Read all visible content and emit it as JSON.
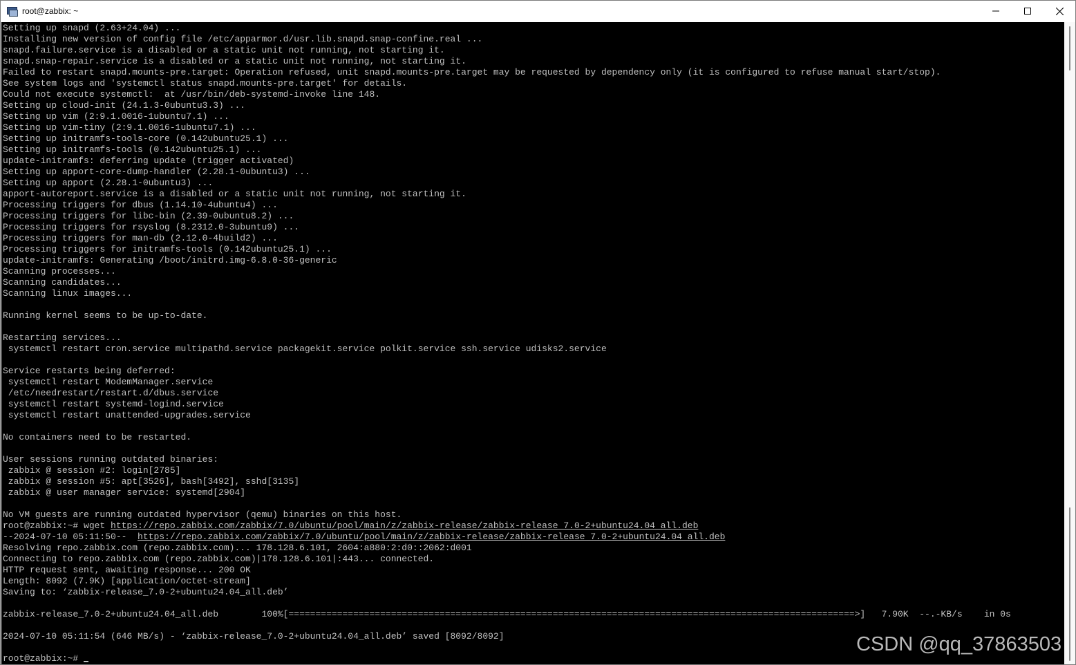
{
  "window": {
    "title": "root@zabbix: ~"
  },
  "terminal": {
    "lines": [
      {
        "text": "Setting up snapd (2.63+24.04) ..."
      },
      {
        "text": "Installing new version of config file /etc/apparmor.d/usr.lib.snapd.snap-confine.real ..."
      },
      {
        "text": "snapd.failure.service is a disabled or a static unit not running, not starting it."
      },
      {
        "text": "snapd.snap-repair.service is a disabled or a static unit not running, not starting it."
      },
      {
        "text": "Failed to restart snapd.mounts-pre.target: Operation refused, unit snapd.mounts-pre.target may be requested by dependency only (it is configured to refuse manual start/stop)."
      },
      {
        "text": "See system logs and 'systemctl status snapd.mounts-pre.target' for details."
      },
      {
        "text": "Could not execute systemctl:  at /usr/bin/deb-systemd-invoke line 148."
      },
      {
        "text": "Setting up cloud-init (24.1.3-0ubuntu3.3) ..."
      },
      {
        "text": "Setting up vim (2:9.1.0016-1ubuntu7.1) ..."
      },
      {
        "text": "Setting up vim-tiny (2:9.1.0016-1ubuntu7.1) ..."
      },
      {
        "text": "Setting up initramfs-tools-core (0.142ubuntu25.1) ..."
      },
      {
        "text": "Setting up initramfs-tools (0.142ubuntu25.1) ..."
      },
      {
        "text": "update-initramfs: deferring update (trigger activated)"
      },
      {
        "text": "Setting up apport-core-dump-handler (2.28.1-0ubuntu3) ..."
      },
      {
        "text": "Setting up apport (2.28.1-0ubuntu3) ..."
      },
      {
        "text": "apport-autoreport.service is a disabled or a static unit not running, not starting it."
      },
      {
        "text": "Processing triggers for dbus (1.14.10-4ubuntu4) ..."
      },
      {
        "text": "Processing triggers for libc-bin (2.39-0ubuntu8.2) ..."
      },
      {
        "text": "Processing triggers for rsyslog (8.2312.0-3ubuntu9) ..."
      },
      {
        "text": "Processing triggers for man-db (2.12.0-4build2) ..."
      },
      {
        "text": "Processing triggers for initramfs-tools (0.142ubuntu25.1) ..."
      },
      {
        "text": "update-initramfs: Generating /boot/initrd.img-6.8.0-36-generic"
      },
      {
        "text": "Scanning processes..."
      },
      {
        "text": "Scanning candidates..."
      },
      {
        "text": "Scanning linux images..."
      },
      {
        "text": ""
      },
      {
        "text": "Running kernel seems to be up-to-date."
      },
      {
        "text": ""
      },
      {
        "text": "Restarting services..."
      },
      {
        "text": " systemctl restart cron.service multipathd.service packagekit.service polkit.service ssh.service udisks2.service"
      },
      {
        "text": ""
      },
      {
        "text": "Service restarts being deferred:"
      },
      {
        "text": " systemctl restart ModemManager.service"
      },
      {
        "text": " /etc/needrestart/restart.d/dbus.service"
      },
      {
        "text": " systemctl restart systemd-logind.service"
      },
      {
        "text": " systemctl restart unattended-upgrades.service"
      },
      {
        "text": ""
      },
      {
        "text": "No containers need to be restarted."
      },
      {
        "text": ""
      },
      {
        "text": "User sessions running outdated binaries:"
      },
      {
        "text": " zabbix @ session #2: login[2785]"
      },
      {
        "text": " zabbix @ session #5: apt[3526], bash[3492], sshd[3135]"
      },
      {
        "text": " zabbix @ user manager service: systemd[2904]"
      },
      {
        "text": ""
      },
      {
        "text": "No VM guests are running outdated hypervisor (qemu) binaries on this host."
      },
      {
        "text": "root@zabbix:~# wget ",
        "link": "https://repo.zabbix.com/zabbix/7.0/ubuntu/pool/main/z/zabbix-release/zabbix-release_7.0-2+ubuntu24.04_all.deb"
      },
      {
        "text": "--2024-07-10 05:11:50--  ",
        "link": "https://repo.zabbix.com/zabbix/7.0/ubuntu/pool/main/z/zabbix-release/zabbix-release_7.0-2+ubuntu24.04_all.deb"
      },
      {
        "text": "Resolving repo.zabbix.com (repo.zabbix.com)... 178.128.6.101, 2604:a880:2:d0::2062:d001"
      },
      {
        "text": "Connecting to repo.zabbix.com (repo.zabbix.com)|178.128.6.101|:443... connected."
      },
      {
        "text": "HTTP request sent, awaiting response... 200 OK"
      },
      {
        "text": "Length: 8092 (7.9K) [application/octet-stream]"
      },
      {
        "text": "Saving to: ‘zabbix-release_7.0-2+ubuntu24.04_all.deb’"
      },
      {
        "text": ""
      },
      {
        "text": "zabbix-release_7.0-2+ubuntu24.04_all.deb        100%[=========================================================================================================>]   7.90K  --.-KB/s    in 0s"
      },
      {
        "text": ""
      },
      {
        "text": "2024-07-10 05:11:54 (646 MB/s) - ‘zabbix-release_7.0-2+ubuntu24.04_all.deb’ saved [8092/8092]"
      },
      {
        "text": ""
      },
      {
        "text": "root@zabbix:~# ",
        "cursor": true
      }
    ]
  },
  "watermark": {
    "text": "CSDN @qq_37863503"
  },
  "icons": {
    "app": "putty-terminal-icon",
    "minimize": "minimize-icon",
    "maximize": "maximize-icon",
    "close": "close-icon"
  },
  "colors": {
    "terminal_bg": "#000000",
    "terminal_fg": "#c0c0c0",
    "titlebar_bg": "#ffffff"
  }
}
